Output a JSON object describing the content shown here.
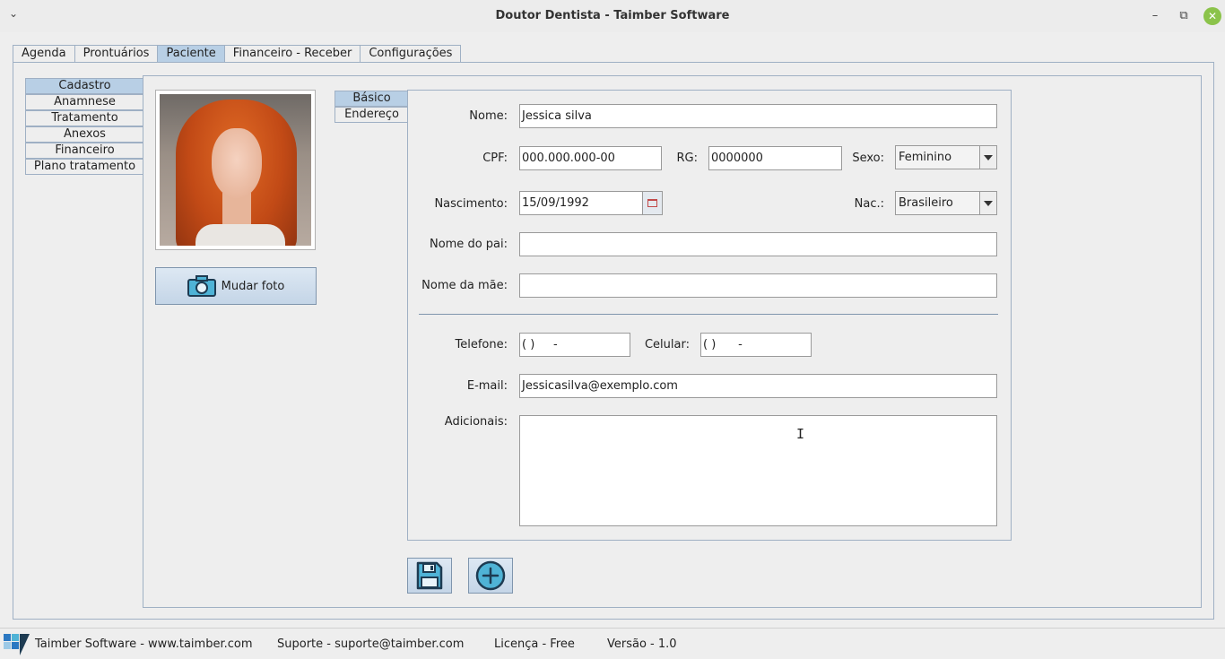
{
  "window": {
    "title": "Doutor Dentista - Taimber Software",
    "menu_icon": "chevron-down-icon",
    "controls": [
      "minimize-icon",
      "restore-icon",
      "close-icon"
    ]
  },
  "main_tabs": [
    {
      "label": "Agenda",
      "active": false
    },
    {
      "label": "Prontuários",
      "active": false
    },
    {
      "label": "Paciente",
      "active": true
    },
    {
      "label": "Financeiro - Receber",
      "active": false
    },
    {
      "label": "Configurações",
      "active": false
    }
  ],
  "side_tabs": [
    {
      "label": "Cadastro",
      "active": true
    },
    {
      "label": "Anamnese",
      "active": false
    },
    {
      "label": "Tratamento",
      "active": false
    },
    {
      "label": "Anexos",
      "active": false
    },
    {
      "label": "Financeiro",
      "active": false
    },
    {
      "label": "Plano tratamento",
      "active": false
    }
  ],
  "photo": {
    "change_label": "Mudar foto",
    "icon": "camera-icon"
  },
  "form_tabs": [
    {
      "label": "Básico",
      "active": true
    },
    {
      "label": "Endereço",
      "active": false
    }
  ],
  "form": {
    "nome": {
      "label": "Nome:",
      "value": "Jessica silva"
    },
    "cpf": {
      "label": "CPF:",
      "value": "000.000.000-00"
    },
    "rg": {
      "label": "RG:",
      "value": "0000000"
    },
    "sexo": {
      "label": "Sexo:",
      "value": "Feminino"
    },
    "nascimento": {
      "label": "Nascimento:",
      "value": "15/09/1992"
    },
    "nac": {
      "label": "Nac.:",
      "value": "Brasileiro"
    },
    "pai": {
      "label": "Nome do pai:",
      "value": ""
    },
    "mae": {
      "label": "Nome da mãe:",
      "value": ""
    },
    "telefone": {
      "label": "Telefone:",
      "value": "( )     -"
    },
    "celular": {
      "label": "Celular:",
      "value": "( )      -"
    },
    "email": {
      "label": "E-mail:",
      "value": "Jessicasilva@exemplo.com"
    },
    "adicionais": {
      "label": "Adicionais:",
      "value": ""
    }
  },
  "actions": [
    {
      "name": "save-button",
      "icon": "floppy-disk-icon"
    },
    {
      "name": "add-button",
      "icon": "plus-circle-icon"
    }
  ],
  "status_bar": {
    "company": "Taimber Software - www.taimber.com",
    "support": "Suporte - suporte@taimber.com",
    "license": "Licença - Free",
    "version": "Versão - 1.0",
    "logo_icon": "taimber-logo-icon"
  },
  "colors": {
    "active_tab": "#b8cfe5",
    "border": "#9fb0c4",
    "accent_close": "#8bc34a"
  }
}
